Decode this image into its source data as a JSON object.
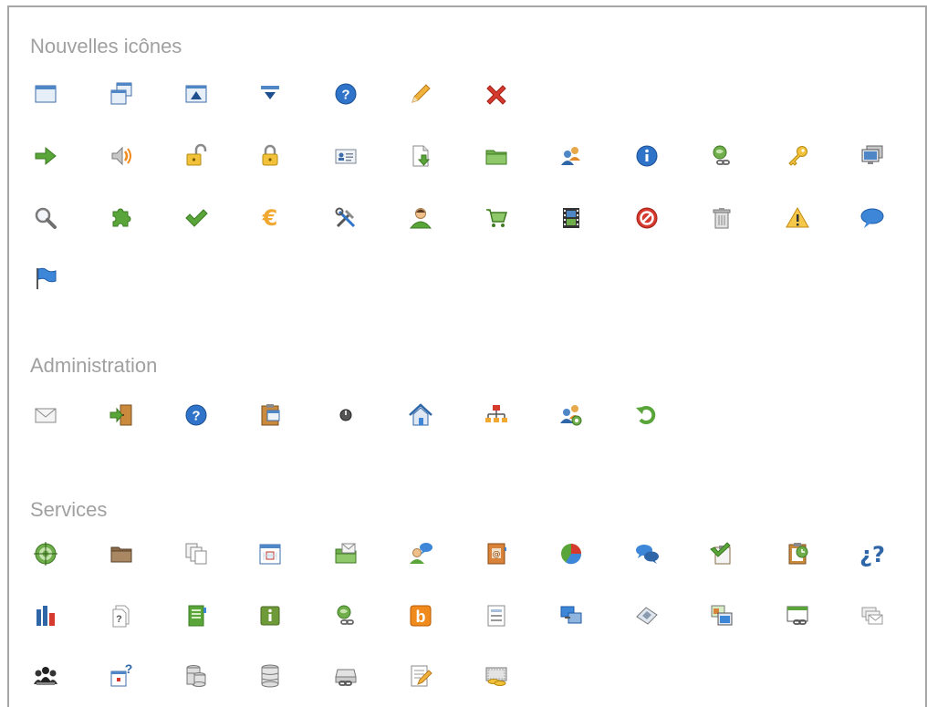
{
  "sections": [
    {
      "title": "Nouvelles icônes",
      "icons": [
        [
          "window-icon",
          "window-stack-icon",
          "window-up-icon",
          "dropdown-icon",
          "help-icon",
          "pencil-icon",
          "delete-icon"
        ],
        [
          "arrow-right-icon",
          "speaker-icon",
          "unlock-icon",
          "lock-icon",
          "id-card-icon",
          "document-download-icon",
          "folder-icon",
          "users-icon",
          "info-icon",
          "network-link-icon",
          "key-icon",
          "monitor-icon"
        ],
        [
          "search-icon",
          "puzzle-icon",
          "check-icon",
          "euro-icon",
          "tools-icon",
          "user-icon",
          "cart-icon",
          "film-icon",
          "forbidden-icon",
          "trash-icon",
          "warning-icon",
          "speech-bubble-icon"
        ],
        [
          "flag-icon"
        ]
      ]
    },
    {
      "title": "Administration",
      "icons": [
        [
          "mail-icon",
          "exit-door-icon",
          "help-icon",
          "clipboard-icon",
          "power-icon",
          "home-icon",
          "org-chart-icon",
          "group-settings-icon",
          "refresh-icon"
        ]
      ]
    },
    {
      "title": "Services",
      "icons": [
        [
          "target-icon",
          "folder-brown-icon",
          "copy-icon",
          "calendar-icon",
          "folder-mail-icon",
          "user-chat-icon",
          "address-book-icon",
          "pie-chart-icon",
          "chat-bubbles-icon",
          "clipboard-check-icon",
          "clipboard-clock-icon",
          "question-mark-icon"
        ],
        [
          "bar-chart-icon",
          "document-help-icon",
          "book-icon",
          "info-box-icon",
          "network-link-icon",
          "blog-icon",
          "form-icon",
          "screens-icon",
          "ticket-icon",
          "images-icon",
          "window-link-icon",
          "mail-stack-icon"
        ],
        [
          "meeting-icon",
          "window-help-icon",
          "database-stack-icon",
          "database-icon",
          "drive-link-icon",
          "edit-note-icon",
          "money-icon"
        ]
      ]
    }
  ]
}
